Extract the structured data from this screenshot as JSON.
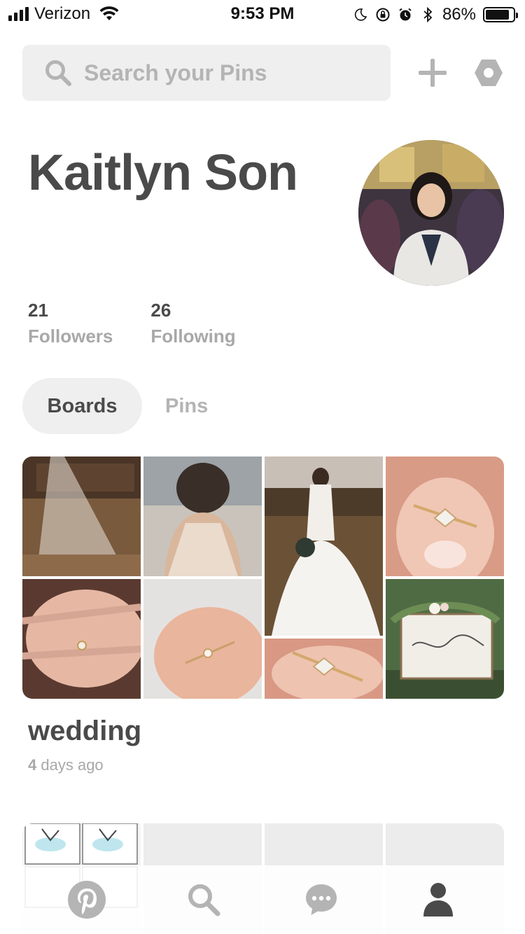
{
  "status_bar": {
    "carrier": "Verizon",
    "time": "9:53 PM",
    "battery_percent": "86%",
    "battery_level": 0.86
  },
  "search": {
    "placeholder": "Search your Pins"
  },
  "profile": {
    "name": "Kaitlyn Son",
    "followers_count": "21",
    "followers_label": "Followers",
    "following_count": "26",
    "following_label": "Following"
  },
  "tabs": {
    "boards": "Boards",
    "pins": "Pins"
  },
  "boards": [
    {
      "title": "wedding",
      "age_prefix": "4",
      "age_suffix": "days ago"
    }
  ],
  "icons": {
    "search": "search-icon",
    "add": "plus-icon",
    "settings": "hexagon-settings-icon",
    "nav_home": "pinterest-logo-icon",
    "nav_search": "search-icon",
    "nav_messages": "chat-bubble-icon",
    "nav_profile": "person-icon"
  },
  "colors": {
    "text_dark": "#4a4a4a",
    "text_muted": "#a8a8a8",
    "pill_bg": "#efefef",
    "icon_gray": "#b4b4b4",
    "nav_active": "#4a4a4a"
  }
}
